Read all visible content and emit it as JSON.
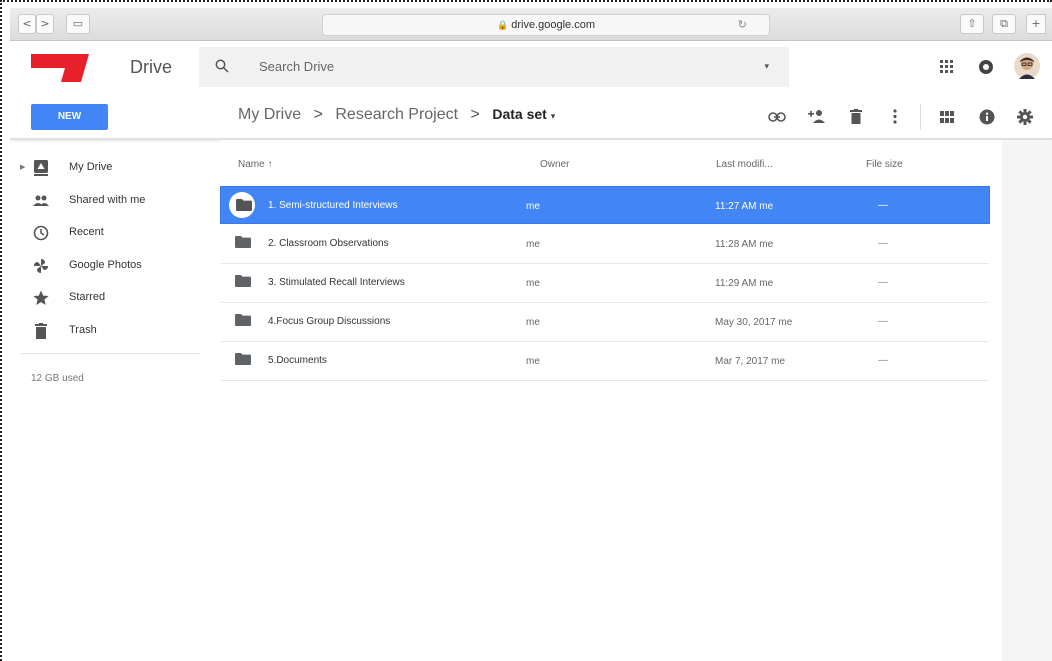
{
  "browser": {
    "url": "drive.google.com",
    "back_glyph": "<",
    "forward_glyph": ">",
    "sidebar_glyph": "▭",
    "reload_glyph": "↻",
    "share_glyph": "⇧",
    "tabs_glyph": "⧉",
    "newtab_glyph": "+"
  },
  "header": {
    "app_name": "Drive",
    "search_placeholder": "Search Drive",
    "search_dropdown_glyph": "▾"
  },
  "toolbar": {
    "new_label": "NEW",
    "breadcrumb": [
      {
        "label": "My Drive"
      },
      {
        "label": "Research Project"
      }
    ],
    "breadcrumb_separator": ">",
    "current_folder": "Data set",
    "current_folder_dropdown": "▾"
  },
  "sidebar": {
    "items": [
      {
        "label": "My Drive",
        "icon": "drive-icon",
        "has_caret": true
      },
      {
        "label": "Shared with me",
        "icon": "people-icon"
      },
      {
        "label": "Recent",
        "icon": "clock-icon"
      },
      {
        "label": "Google Photos",
        "icon": "pinwheel-icon"
      },
      {
        "label": "Starred",
        "icon": "star-icon"
      },
      {
        "label": "Trash",
        "icon": "trash-icon"
      }
    ],
    "caret_glyph": "▶",
    "storage": "12 GB used"
  },
  "columns": {
    "name": "Name ↑",
    "owner": "Owner",
    "modified": "Last modifi...",
    "size": "File size"
  },
  "files": [
    {
      "name": "1. Semi-structured Interviews",
      "owner": "me",
      "modified": "11:27 AM me",
      "size": "—",
      "selected": true
    },
    {
      "name": "2. Classroom Observations",
      "owner": "me",
      "modified": "11:28 AM me",
      "size": "—"
    },
    {
      "name": "3. Stimulated Recall Interviews",
      "owner": "me",
      "modified": "11:29 AM me",
      "size": "—"
    },
    {
      "name": "4.Focus Group Discussions",
      "owner": "me",
      "modified": "May 30, 2017 me",
      "size": "—"
    },
    {
      "name": "5.Documents",
      "owner": "me",
      "modified": "Mar 7, 2017 me",
      "size": "—"
    }
  ],
  "colors": {
    "accent": "#4285f4",
    "logo_red": "#e8202a"
  }
}
